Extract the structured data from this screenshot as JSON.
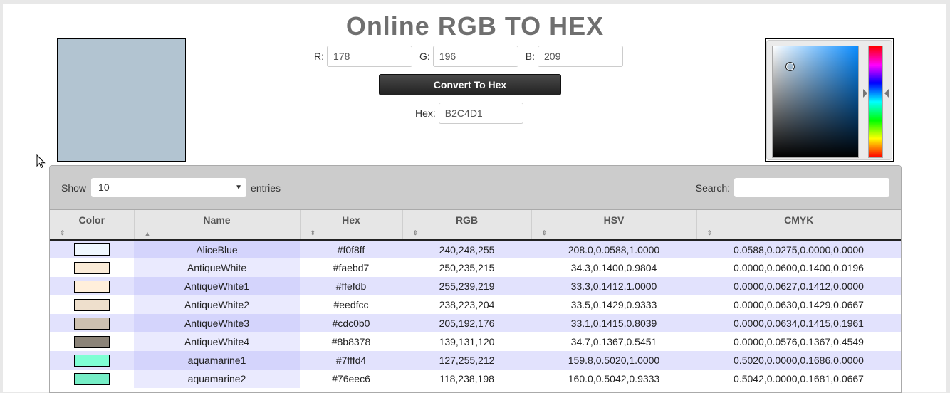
{
  "header": {
    "title": "Online RGB TO HEX"
  },
  "preview": {
    "color": "#b2c4d1"
  },
  "form": {
    "r_label": "R:",
    "r_value": "178",
    "g_label": "G:",
    "g_value": "196",
    "b_label": "B:",
    "b_value": "209",
    "convert_label": "Convert To Hex",
    "hex_label": "Hex:",
    "hex_value": "B2C4D1"
  },
  "picker": {
    "icon": "color-picker"
  },
  "table_controls": {
    "show_label": "Show",
    "entries_value": "10",
    "entries_label": "entries",
    "search_label": "Search:",
    "search_value": ""
  },
  "table": {
    "columns": [
      "Color",
      "Name",
      "Hex",
      "RGB",
      "HSV",
      "CMYK"
    ],
    "sorted_column": "Name",
    "rows": [
      {
        "swatch": "#f0f8ff",
        "name": "AliceBlue",
        "hex": "#f0f8ff",
        "rgb": "240,248,255",
        "hsv": "208.0,0.0588,1.0000",
        "cmyk": "0.0588,0.0275,0.0000,0.0000"
      },
      {
        "swatch": "#faebd7",
        "name": "AntiqueWhite",
        "hex": "#faebd7",
        "rgb": "250,235,215",
        "hsv": "34.3,0.1400,0.9804",
        "cmyk": "0.0000,0.0600,0.1400,0.0196"
      },
      {
        "swatch": "#ffefdb",
        "name": "AntiqueWhite1",
        "hex": "#ffefdb",
        "rgb": "255,239,219",
        "hsv": "33.3,0.1412,1.0000",
        "cmyk": "0.0000,0.0627,0.1412,0.0000"
      },
      {
        "swatch": "#eedfcc",
        "name": "AntiqueWhite2",
        "hex": "#eedfcc",
        "rgb": "238,223,204",
        "hsv": "33.5,0.1429,0.9333",
        "cmyk": "0.0000,0.0630,0.1429,0.0667"
      },
      {
        "swatch": "#cdc0b0",
        "name": "AntiqueWhite3",
        "hex": "#cdc0b0",
        "rgb": "205,192,176",
        "hsv": "33.1,0.1415,0.8039",
        "cmyk": "0.0000,0.0634,0.1415,0.1961"
      },
      {
        "swatch": "#8b8378",
        "name": "AntiqueWhite4",
        "hex": "#8b8378",
        "rgb": "139,131,120",
        "hsv": "34.7,0.1367,0.5451",
        "cmyk": "0.0000,0.0576,0.1367,0.4549"
      },
      {
        "swatch": "#7fffd4",
        "name": "aquamarine1",
        "hex": "#7fffd4",
        "rgb": "127,255,212",
        "hsv": "159.8,0.5020,1.0000",
        "cmyk": "0.5020,0.0000,0.1686,0.0000"
      },
      {
        "swatch": "#76eec6",
        "name": "aquamarine2",
        "hex": "#76eec6",
        "rgb": "118,238,198",
        "hsv": "160.0,0.5042,0.9333",
        "cmyk": "0.5042,0.0000,0.1681,0.0667"
      }
    ]
  }
}
